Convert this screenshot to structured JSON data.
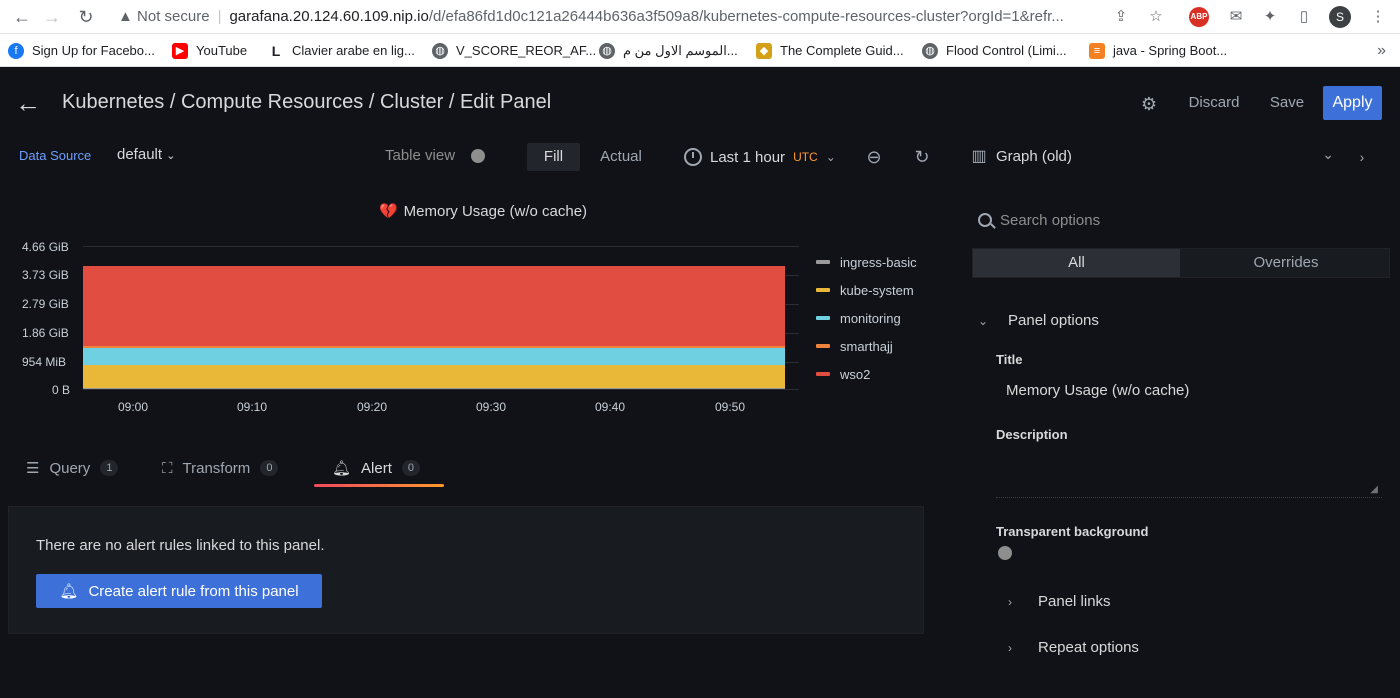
{
  "browser": {
    "security_label": "Not secure",
    "url_host": "garafana.20.124.60.109.nip.io",
    "url_path": "/d/efa86fd1d0c121a26444b636a3f509a8/kubernetes-compute-resources-cluster?orgId=1&refr...",
    "avatar_letter": "S",
    "abp_label": "ABP",
    "bookmarks": [
      {
        "label": "Sign Up for Facebo...",
        "icon": "facebook-icon",
        "color": "#1877f2"
      },
      {
        "label": "YouTube",
        "icon": "youtube-icon",
        "color": "#ff0000"
      },
      {
        "label": "Clavier arabe en lig...",
        "icon": "l-logo-icon",
        "color": "#202124"
      },
      {
        "label": "V_SCORE_REOR_AF...",
        "icon": "globe-icon",
        "color": "#5f6368"
      },
      {
        "label": "الموسم الاول من م...",
        "icon": "globe-icon",
        "color": "#5f6368"
      },
      {
        "label": "The Complete Guid...",
        "icon": "guide-icon",
        "color": "#d4a017"
      },
      {
        "label": "Flood Control (Limi...",
        "icon": "globe-icon",
        "color": "#5f6368"
      },
      {
        "label": "java - Spring Boot...",
        "icon": "stackoverflow-icon",
        "color": "#f48024"
      }
    ]
  },
  "header": {
    "title": "Kubernetes / Compute Resources / Cluster / Edit Panel",
    "discard": "Discard",
    "save": "Save",
    "apply": "Apply"
  },
  "toolbar": {
    "datasource_label": "Data Source",
    "datasource_value": "default",
    "table_view": "Table view",
    "fill": "Fill",
    "actual": "Actual",
    "time_range": "Last 1 hour",
    "timezone": "UTC"
  },
  "viz_picker": {
    "label": "Graph (old)"
  },
  "panel": {
    "title": "Memory Usage (w/o cache)"
  },
  "chart_data": {
    "type": "area",
    "title": "Memory Usage (w/o cache)",
    "stacked": true,
    "x": [
      "09:00",
      "09:10",
      "09:20",
      "09:30",
      "09:40",
      "09:50"
    ],
    "y_ticks": [
      "4.66 GiB",
      "3.73 GiB",
      "2.79 GiB",
      "1.86 GiB",
      "954 MiB",
      "0 B"
    ],
    "ylim_gib": [
      0,
      4.66
    ],
    "series": [
      {
        "name": "ingress-basic",
        "color": "#9a9a9a",
        "values_gib": [
          0.02,
          0.02,
          0.02,
          0.02,
          0.02,
          0.02
        ]
      },
      {
        "name": "kube-system",
        "color": "#eab839",
        "values_gib": [
          0.75,
          0.75,
          0.75,
          0.75,
          0.75,
          0.75
        ]
      },
      {
        "name": "monitoring",
        "color": "#6ed0e0",
        "values_gib": [
          0.55,
          0.55,
          0.55,
          0.55,
          0.55,
          0.55
        ]
      },
      {
        "name": "smarthajj",
        "color": "#ef843c",
        "values_gib": [
          0.08,
          0.08,
          0.08,
          0.08,
          0.08,
          0.08
        ]
      },
      {
        "name": "wso2",
        "color": "#e24d42",
        "values_gib": [
          2.6,
          2.6,
          2.6,
          2.6,
          2.6,
          2.6
        ]
      }
    ],
    "legend_position": "right"
  },
  "tabs": [
    {
      "label": "Query",
      "count": "1"
    },
    {
      "label": "Transform",
      "count": "0"
    },
    {
      "label": "Alert",
      "count": "0"
    }
  ],
  "alert": {
    "empty_text": "There are no alert rules linked to this panel.",
    "create_button": "Create alert rule from this panel"
  },
  "options": {
    "search_placeholder": "Search options",
    "tab_all": "All",
    "tab_overrides": "Overrides",
    "panel_options": "Panel options",
    "title_label": "Title",
    "title_value": "Memory Usage (w/o cache)",
    "description_label": "Description",
    "transparent_label": "Transparent background",
    "panel_links": "Panel links",
    "repeat_options": "Repeat options"
  }
}
